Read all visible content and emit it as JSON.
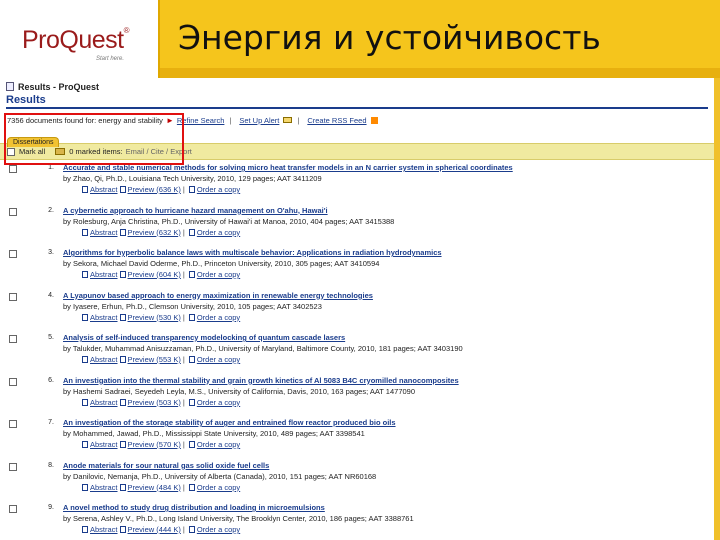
{
  "slide": {
    "logo": {
      "text": "ProQuest",
      "mark": "®",
      "tagline": "Start here."
    },
    "title": "Энергия и устойчивость"
  },
  "browser": {
    "window_title": "Results - ProQuest",
    "heading": "Results",
    "search_summary": "7356 documents found for: energy and stability",
    "refine_search": "Refine Search",
    "set_up_alert": "Set Up Alert",
    "create_rss": "Create RSS Feed",
    "tab_label": "Dissertations",
    "mark_all": "Mark all",
    "marked_items": "0 marked items:",
    "marked_actions": "Email / Cite / Export"
  },
  "results": [
    {
      "num": "1.",
      "title": "Accurate and stable numerical methods for solving micro heat transfer models in an N carrier system in spherical coordinates",
      "meta": "by Zhao, Qi, Ph.D., Louisiana Tech University, 2010, 129 pages; AAT 3411209",
      "abstract": "Abstract",
      "preview": "Preview (636 K)",
      "order": "Order a copy"
    },
    {
      "num": "2.",
      "title": "A cybernetic approach to hurricane hazard management on O'ahu, Hawai'i",
      "meta": "by Rolesburg, Anja Christina, Ph.D., University of Hawai'i at Manoa, 2010, 404 pages; AAT 3415388",
      "abstract": "Abstract",
      "preview": "Preview (632 K)",
      "order": "Order a copy"
    },
    {
      "num": "3.",
      "title": "Algorithms for hyperbolic balance laws with multiscale behavior: Applications in radiation hydrodynamics",
      "meta": "by Sekora, Michael David Oderme, Ph.D., Princeton University, 2010, 305 pages; AAT 3410594",
      "abstract": "Abstract",
      "preview": "Preview (604 K)",
      "order": "Order a copy"
    },
    {
      "num": "4.",
      "title": "A Lyapunov based approach to energy maximization in renewable energy technologies",
      "meta": "by Iyasere, Erhun, Ph.D., Clemson University, 2010, 105 pages; AAT 3402523",
      "abstract": "Abstract",
      "preview": "Preview (530 K)",
      "order": "Order a copy"
    },
    {
      "num": "5.",
      "title": "Analysis of self-induced transparency modelocking of quantum cascade lasers",
      "meta": "by Talukder, Muhammad Anisuzzaman, Ph.D., University of Maryland, Baltimore County, 2010, 181 pages; AAT 3403190",
      "abstract": "Abstract",
      "preview": "Preview (553 K)",
      "order": "Order a copy"
    },
    {
      "num": "6.",
      "title": "An investigation into the thermal stability and grain growth kinetics of Al 5083 B4C cryomilled nanocomposites",
      "meta": "by Hashemi Sadraei, Seyedeh Leyla, M.S., University of California, Davis, 2010, 163 pages; AAT 1477090",
      "abstract": "Abstract",
      "preview": "Preview (503 K)",
      "order": "Order a copy"
    },
    {
      "num": "7.",
      "title": "An investigation of the storage stability of auger and entrained flow reactor produced bio oils",
      "meta": "by Mohammed, Jawad, Ph.D., Mississippi State University, 2010, 489 pages; AAT 3398541",
      "abstract": "Abstract",
      "preview": "Preview (570 K)",
      "order": "Order a copy"
    },
    {
      "num": "8.",
      "title": "Anode materials for sour natural gas solid oxide fuel cells",
      "meta": "by Danilovic, Nemanja, Ph.D., University of Alberta (Canada), 2010, 151 pages; AAT NR60168",
      "abstract": "Abstract",
      "preview": "Preview (484 K)",
      "order": "Order a copy"
    },
    {
      "num": "9.",
      "title": "A novel method to study drug distribution and loading in microemulsions",
      "meta": "by Serena, Ashley V., Ph.D., Long Island University, The Brooklyn Center, 2010, 186 pages; AAT 3388761",
      "abstract": "Abstract",
      "preview": "Preview (444 K)",
      "order": "Order a copy"
    }
  ],
  "colors": {
    "title_band": "#f5c51c",
    "link_blue": "#1a3c8c",
    "highlight_box": "#e01010",
    "mark_bar": "#f0eaa0"
  },
  "icons": [
    "page-icon",
    "arrow-right-icon",
    "mail-icon",
    "rss-icon",
    "folder-icon",
    "abstract-icon",
    "preview-icon",
    "order-icon"
  ]
}
